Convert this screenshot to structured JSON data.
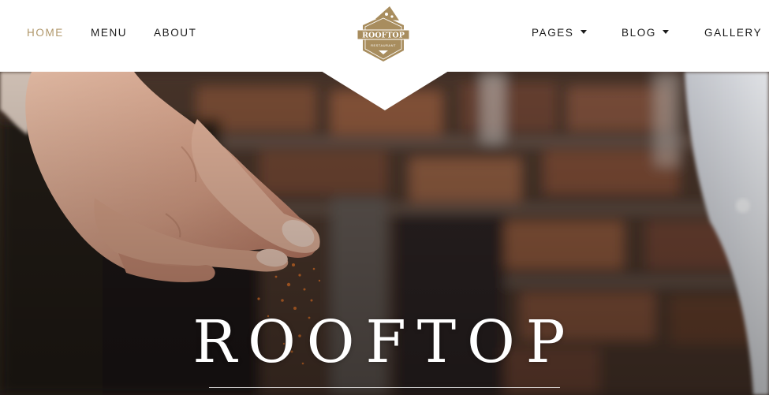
{
  "nav": {
    "left": [
      {
        "label": "HOME",
        "active": true
      },
      {
        "label": "MENU",
        "active": false
      },
      {
        "label": "ABOUT",
        "active": false
      }
    ],
    "right": [
      {
        "label": "PAGES",
        "dropdown": true
      },
      {
        "label": "BLOG",
        "dropdown": true
      },
      {
        "label": "GALLERY",
        "dropdown": false
      }
    ]
  },
  "logo": {
    "name": "ROOFTOP",
    "tagline": "RESTAURANT",
    "color": "#a88d5e"
  },
  "hero": {
    "title": "ROOFTOP",
    "image": "chef-hand-sprinkling-spice"
  },
  "colors": {
    "accent": "#b0976a",
    "nav_text": "#1c1c1c"
  }
}
